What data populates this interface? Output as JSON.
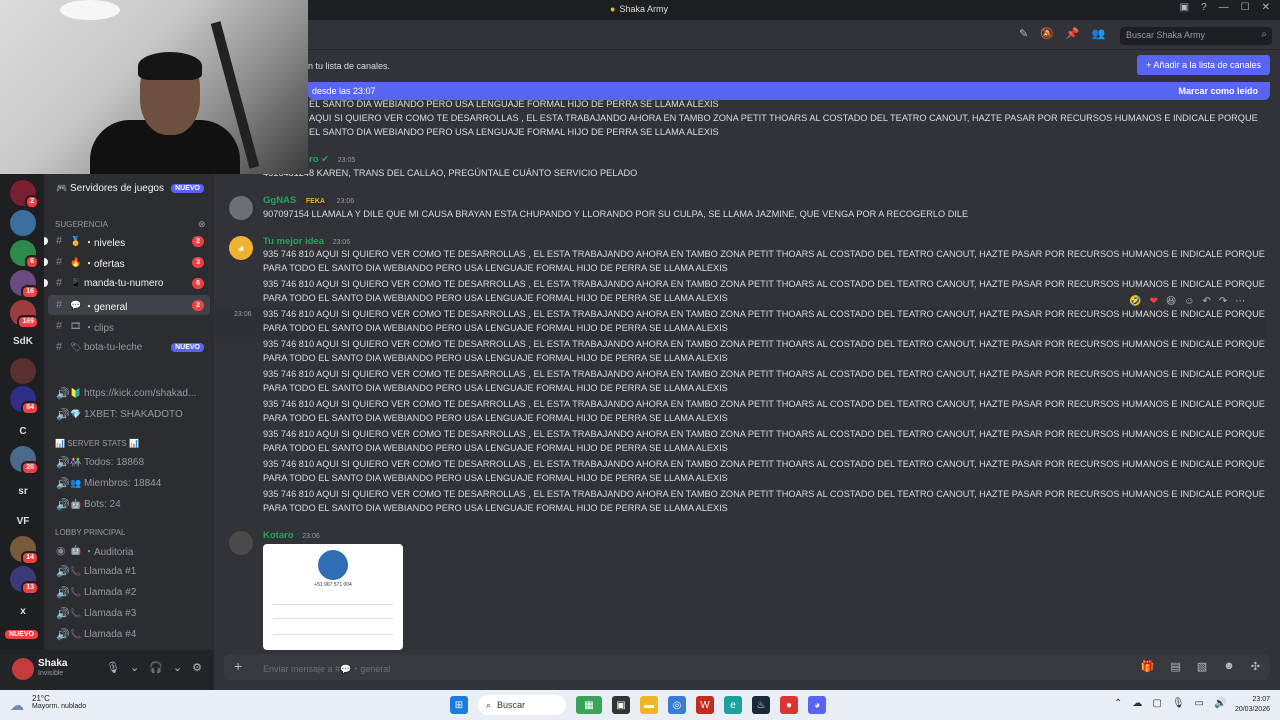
{
  "window": {
    "title": "Shaka Army"
  },
  "header": {
    "search_placeholder": "Buscar Shaka Army"
  },
  "banner": {
    "text": "n tu lista de canales.",
    "button": "+ Añadir a la lista de canales"
  },
  "new_bar": {
    "left": "desde las 23:07",
    "right": "Marcar como leído"
  },
  "rail": {
    "sdk": "SdK",
    "c": "C",
    "sr": "sr",
    "vf": "VF",
    "x": "x",
    "nuevo": "NUEVO",
    "badges": [
      "2",
      "6",
      "16",
      "169",
      "84",
      "20",
      "14",
      "13"
    ]
  },
  "sidebar": {
    "top_item": {
      "label": "Servidores de juegos",
      "badge": "NUEVO"
    },
    "category_sugerencia": "Sugerencia",
    "channels": [
      {
        "label": "・niveles",
        "count": "2"
      },
      {
        "label": "・ofertas",
        "count": "3"
      },
      {
        "label": "manda-tu-numero",
        "count": "6"
      },
      {
        "label": "・general",
        "count": "2"
      },
      {
        "label": "・clips",
        "count": ""
      },
      {
        "label": "bota-tu-leche",
        "badge": "NUEVO"
      }
    ],
    "links": [
      "https://kick.com/shakad...",
      "1XBET: SHAKADOTO"
    ],
    "category_stats": "SERVER STATS",
    "stats": [
      "Todos: 18868",
      "Miembros: 18844",
      "Bots: 24"
    ],
    "category_lobby": "LOBBY PRINCIPAL",
    "voice": [
      "・Auditoria",
      "Llamada #1",
      "Llamada #2",
      "Llamada #3",
      "Llamada #4"
    ]
  },
  "user": {
    "name": "Shaka",
    "status": "Invisible"
  },
  "messages": {
    "repeat_a": "935 746 810 AQUI SI QUIERO VER COMO TE DESARROLLAS , EL ESTA TRABAJANDO AHORA EN TAMBO ZONA PETIT THOARS AL COSTADO DEL TEATRO CANOUT, HAZTE PASAR POR RECURSOS HUMANOS E INDICALE PORQUE",
    "repeat_b": "PARA TODO EL SANTO DIA WEBIANDO PERO USA LENGUAJE FORMAL HIJO DE PERRA SE LLAMA ALEXIS",
    "top_partial": "EL SANTO DIA WEBIANDO PERO USA LENGUAJE FORMAL HIJO DE PERRA SE LLAMA ALEXIS",
    "top_a": "AQUI SI QUIERO VER COMO TE DESARROLLAS , EL ESTA TRABAJANDO AHORA EN TAMBO ZONA PETIT THOARS AL COSTADO DEL TEATRO CANOUT, HAZTE PASAR POR RECURSOS HUMANOS E INDICALE PORQUE",
    "top_b": "EL SANTO DIA WEBIANDO PERO USA LENGUAJE FORMAL HIJO DE PERRA SE LLAMA ALEXIS",
    "m1": {
      "author": "ro",
      "time": "23:05",
      "text": "4516481248 KAREN, TRANS DEL CALLAO, PREGÚNTALE CUÁNTO SERVICIO PELADO"
    },
    "m2": {
      "author": "GgNAS",
      "tag": "FEKA",
      "time": "23:06",
      "text": "907097154 LLAMALA Y DILE QUE MI CAUSA BRAYAN ESTA CHUPANDO Y LLORANDO POR SU CULPA, SE LLAMA JAZMINE, QUE VENGA POR A RECOGERLO DILE"
    },
    "m3": {
      "author": "Tu mejor idea",
      "time": "23:06",
      "hover_time": "23:06"
    },
    "m4": {
      "author": "Kotaro",
      "time": "23:06",
      "phone": "+51 967 571 004"
    }
  },
  "composer": {
    "placeholder": "Enviar mensaje a #💬・general"
  },
  "taskbar": {
    "temp": "21°C",
    "weather": "Mayorm. nublado",
    "search": "Buscar",
    "time": "23:07",
    "date": "20/03/2026"
  },
  "colors": {
    "accent": "#5865f2",
    "green_name": "#23a55a",
    "badge_red": "#f23f43"
  }
}
